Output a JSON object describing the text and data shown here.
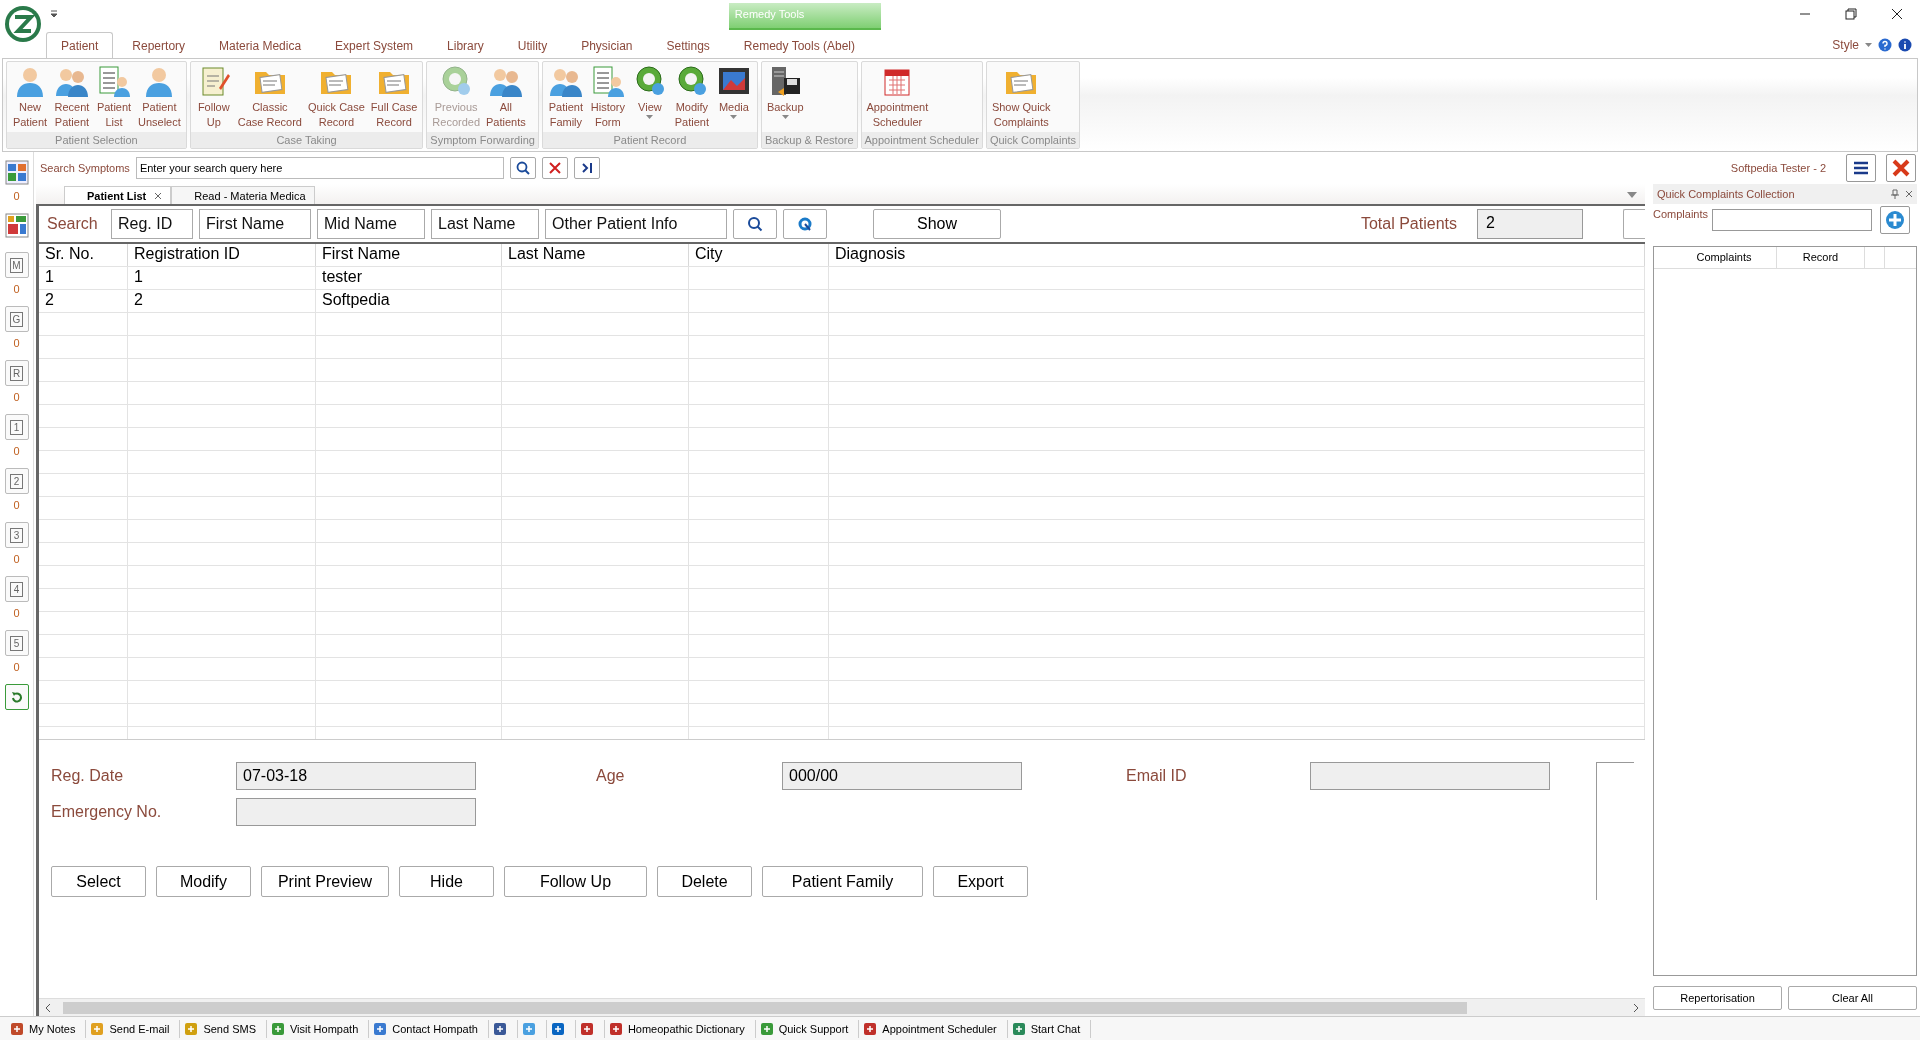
{
  "window": {
    "context_tab": "Remedy Tools",
    "style_label": "Style"
  },
  "tabs": [
    {
      "label": "Patient",
      "selected": true
    },
    {
      "label": "Repertory",
      "selected": false
    },
    {
      "label": "Materia Medica",
      "selected": false
    },
    {
      "label": "Expert System",
      "selected": false
    },
    {
      "label": "Library",
      "selected": false
    },
    {
      "label": "Utility",
      "selected": false
    },
    {
      "label": "Physician",
      "selected": false
    },
    {
      "label": "Settings",
      "selected": false
    },
    {
      "label": "Remedy Tools (Abel)",
      "selected": false
    }
  ],
  "ribbon": {
    "groups": [
      {
        "label": "Patient Selection",
        "buttons": [
          {
            "label": "New\nPatient",
            "disabled": false,
            "has_menu": false
          },
          {
            "label": "Recent\nPatient",
            "disabled": false,
            "has_menu": false
          },
          {
            "label": "Patient\nList",
            "disabled": false,
            "has_menu": false
          },
          {
            "label": "Patient\nUnselect",
            "disabled": false,
            "has_menu": false
          }
        ]
      },
      {
        "label": "Case Taking",
        "buttons": [
          {
            "label": "Follow\nUp",
            "disabled": false,
            "has_menu": false
          },
          {
            "label": "Classic\nCase Record",
            "disabled": false,
            "has_menu": false
          },
          {
            "label": "Quick Case\nRecord",
            "disabled": false,
            "has_menu": false
          },
          {
            "label": "Full Case\nRecord",
            "disabled": false,
            "has_menu": false
          }
        ]
      },
      {
        "label": "Symptom Forwarding",
        "buttons": [
          {
            "label": "Previous\nRecorded",
            "disabled": true,
            "has_menu": false
          },
          {
            "label": "All\nPatients",
            "disabled": false,
            "has_menu": false
          }
        ]
      },
      {
        "label": "Patient Record",
        "buttons": [
          {
            "label": "Patient\nFamily",
            "disabled": false,
            "has_menu": false
          },
          {
            "label": "History\nForm",
            "disabled": false,
            "has_menu": false
          },
          {
            "label": "View",
            "disabled": false,
            "has_menu": true
          },
          {
            "label": "Modify\nPatient",
            "disabled": false,
            "has_menu": false
          },
          {
            "label": "Media",
            "disabled": false,
            "has_menu": true
          }
        ]
      },
      {
        "label": "Backup & Restore",
        "buttons": [
          {
            "label": "Backup",
            "disabled": false,
            "has_menu": true
          }
        ]
      },
      {
        "label": "Appointment Scheduler",
        "buttons": [
          {
            "label": "Appointment\nScheduler",
            "disabled": false,
            "has_menu": false
          }
        ]
      },
      {
        "label": "Quick Complaints",
        "buttons": [
          {
            "label": "Show Quick\nComplaints",
            "disabled": false,
            "has_menu": false
          }
        ]
      }
    ]
  },
  "symptom_search": {
    "label": "Search Symptoms",
    "placeholder": "Enter your search query here",
    "user": "Softpedia Tester - 2"
  },
  "sidebar": {
    "top_count": "0",
    "items": [
      {
        "label": "M",
        "count": "0"
      },
      {
        "label": "G",
        "count": "0"
      },
      {
        "label": "R",
        "count": "0"
      },
      {
        "label": "1",
        "count": "0"
      },
      {
        "label": "2",
        "count": "0"
      },
      {
        "label": "3",
        "count": "0"
      },
      {
        "label": "4",
        "count": "0"
      },
      {
        "label": "5",
        "count": "0"
      }
    ]
  },
  "doc_tabs": [
    {
      "label": "Patient List",
      "selected": true
    },
    {
      "label": "Read - Materia Medica",
      "selected": false
    }
  ],
  "patient_search": {
    "label": "Search",
    "fields": [
      {
        "placeholder": "Reg. ID"
      },
      {
        "placeholder": "First Name"
      },
      {
        "placeholder": "Mid Name"
      },
      {
        "placeholder": "Last Name"
      },
      {
        "placeholder": "Other Patient Info"
      }
    ],
    "show_button": {
      "label": "Show"
    },
    "total_label": "Total Patients",
    "total_value": "2"
  },
  "table": {
    "columns": [
      "Sr. No.",
      "Registration ID",
      "First Name",
      "Last Name",
      "City",
      "Diagnosis"
    ],
    "rows": [
      [
        "1",
        "1",
        "tester",
        "",
        "",
        ""
      ],
      [
        "2",
        "2",
        "Softpedia",
        "",
        "",
        ""
      ]
    ]
  },
  "form": {
    "fields": [
      {
        "label": "Reg. Date",
        "value": "07-03-18"
      },
      {
        "label": "Age",
        "value": "000/00"
      },
      {
        "label": "Email ID"
      },
      {
        "label": "Emergency No."
      }
    ],
    "buttons": [
      {
        "label": "Select"
      },
      {
        "label": "Modify"
      },
      {
        "label": "Print Preview"
      },
      {
        "label": "Hide"
      },
      {
        "label": "Follow Up"
      },
      {
        "label": "Delete"
      },
      {
        "label": "Patient Family"
      },
      {
        "label": "Export"
      }
    ]
  },
  "quick_complaints": {
    "title": "Quick Complaints Collection",
    "field_label": "Complaints",
    "columns": [
      "Complaints",
      "Record"
    ],
    "buttons": [
      "Repertorisation",
      "Clear All"
    ]
  },
  "taskbar": [
    {
      "kind": "link",
      "label": "My Notes"
    },
    {
      "kind": "link",
      "label": "Send E-mail"
    },
    {
      "kind": "link",
      "label": "Send SMS"
    },
    {
      "kind": "link",
      "label": "Visit Hompath"
    },
    {
      "kind": "link",
      "label": "Contact Hompath"
    },
    {
      "kind": "social"
    },
    {
      "kind": "social"
    },
    {
      "kind": "social"
    },
    {
      "kind": "social"
    },
    {
      "kind": "link",
      "label": "Homeopathic Dictionary"
    },
    {
      "kind": "link",
      "label": "Quick Support"
    },
    {
      "kind": "link",
      "label": "Appointment Scheduler"
    },
    {
      "kind": "link",
      "label": "Start Chat"
    }
  ]
}
